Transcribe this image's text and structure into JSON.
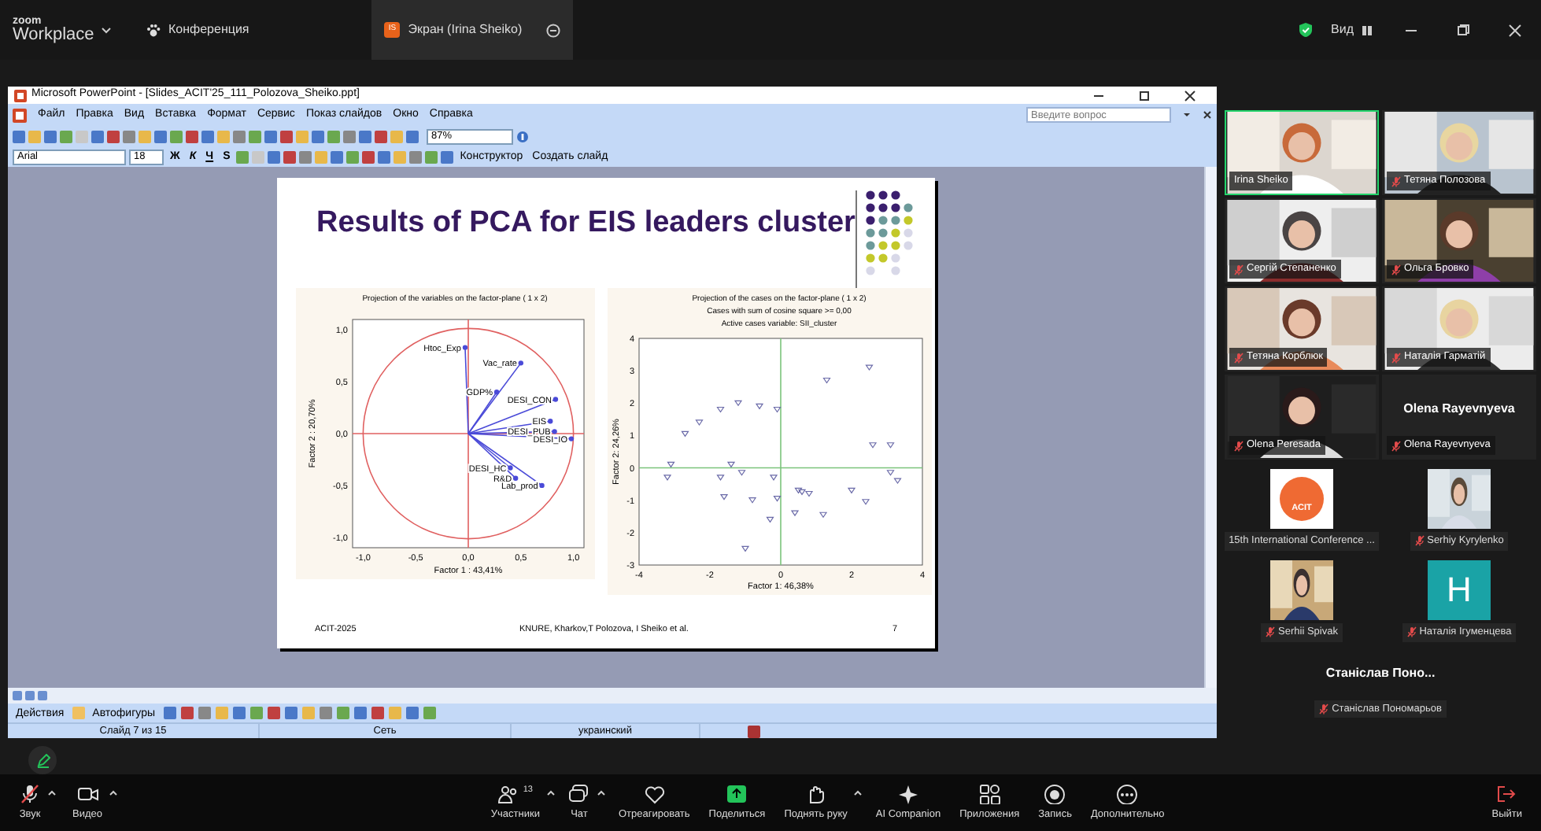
{
  "app": {
    "logo_top": "zoom",
    "logo_bottom": "Workplace",
    "meeting_tab": {
      "label": "Конференция",
      "selected": false
    },
    "share_tab": {
      "avatar": "IS",
      "label": "Экран (Irina Sheiko)",
      "selected": true
    },
    "view_label": "Вид"
  },
  "powerpoint": {
    "title": "Microsoft PowerPoint - [Slides_ACIT'25_111_Polozova_Sheiko.ppt]",
    "menu": [
      "Файл",
      "Правка",
      "Вид",
      "Вставка",
      "Формат",
      "Сервис",
      "Показ слайдов",
      "Окно",
      "Справка"
    ],
    "help_placeholder": "Введите вопрос",
    "zoom": "87%",
    "font": "Arial",
    "font_size": "18",
    "format_buttons": [
      "Ж",
      "К",
      "Ч",
      "S"
    ],
    "design_button": "Конструктор",
    "new_slide_button": "Создать слайд",
    "draw_actions": "Действия",
    "autoshapes": "Автофигуры",
    "status": [
      "Слайд 7 из 15",
      "Сеть",
      "украинский"
    ]
  },
  "slide": {
    "title": "Results of PCA for EIS leaders cluster",
    "panels": [
      {
        "kind": "vectors",
        "chart_data": {
          "type": "scatter",
          "title": "Projection of the variables on the factor-plane ( 1 x  2)",
          "xlabel": "Factor 1 : 43,41%",
          "ylabel": "Factor 2 : 20,70%",
          "xlim": [
            -1.1,
            1.1
          ],
          "ylim": [
            -1.1,
            1.1
          ],
          "xticks": [
            {
              "value": -1,
              "label": "-1,0"
            },
            {
              "value": -0.5,
              "label": "-0,5"
            },
            {
              "value": 0,
              "label": "0,0"
            },
            {
              "value": 0.5,
              "label": "0,5"
            },
            {
              "value": 1,
              "label": "1,0"
            }
          ],
          "yticks": [
            {
              "value": -1,
              "label": "-1,0"
            },
            {
              "value": -0.5,
              "label": "-0,5"
            },
            {
              "value": 0,
              "label": "0,0"
            },
            {
              "value": 0.5,
              "label": "0,5"
            },
            {
              "value": 1,
              "label": "1,0"
            }
          ],
          "annotations": [
            {
              "text": "Htoc_Exp",
              "x": -0.03,
              "y": 0.83
            },
            {
              "text": "Vac_rate",
              "x": 0.5,
              "y": 0.68
            },
            {
              "text": "GDP%",
              "x": 0.27,
              "y": 0.4
            },
            {
              "text": "DESI_CON",
              "x": 0.83,
              "y": 0.33
            },
            {
              "text": "EIS",
              "x": 0.78,
              "y": 0.12
            },
            {
              "text": "DESI_PUB",
              "x": 0.82,
              "y": 0.02
            },
            {
              "text": "DESI_IO",
              "x": 0.98,
              "y": -0.05
            },
            {
              "text": "DESI_HC",
              "x": 0.4,
              "y": -0.33
            },
            {
              "text": "R&D",
              "x": 0.45,
              "y": -0.43
            },
            {
              "text": "Lab_prod",
              "x": 0.7,
              "y": -0.5
            }
          ],
          "x": [
            -0.03,
            0.5,
            0.27,
            0.83,
            0.78,
            0.82,
            0.98,
            0.4,
            0.45,
            0.7
          ],
          "series": [
            {
              "color": "#4a4ad8",
              "values": [
                0.83,
                0.68,
                0.4,
                0.33,
                0.12,
                0.02,
                -0.05,
                -0.33,
                -0.43,
                -0.5
              ]
            }
          ]
        }
      },
      {
        "kind": "points",
        "chart_data": {
          "type": "scatter",
          "title": "Projection of the cases on the factor-plane ( 1 x  2)",
          "annotations": [
            "Cases with sum of cosine square >= 0,00",
            "Active cases variable: SII_cluster"
          ],
          "xlabel": "Factor 1: 46,38%",
          "ylabel": "Factor 2: 24,26%",
          "xlim": [
            -4,
            4
          ],
          "ylim": [
            -3,
            4
          ],
          "xticks": [
            {
              "value": -4,
              "label": "-4"
            },
            {
              "value": -2,
              "label": "-2"
            },
            {
              "value": 0,
              "label": "0"
            },
            {
              "value": 2,
              "label": "2"
            },
            {
              "value": 4,
              "label": "4"
            }
          ],
          "yticks": [
            {
              "value": -3,
              "label": "-3"
            },
            {
              "value": -2,
              "label": "-2"
            },
            {
              "value": -1,
              "label": "-1"
            },
            {
              "value": 0,
              "label": "0"
            },
            {
              "value": 1,
              "label": "1"
            },
            {
              "value": 2,
              "label": "2"
            },
            {
              "value": 3,
              "label": "3"
            },
            {
              "value": 4,
              "label": "4"
            }
          ],
          "x": [
            2.5,
            1.3,
            -1.2,
            -1.7,
            -0.6,
            -0.1,
            -2.3,
            -2.7,
            -3.1,
            -3.2,
            -1.4,
            -1.7,
            -1.1,
            -0.2,
            0.5,
            0.6,
            0.8,
            2.0,
            2.4,
            2.6,
            3.1,
            3.1,
            3.3,
            -1.6,
            -0.8,
            -0.1,
            0.4,
            1.2,
            -0.3,
            -1.0
          ],
          "series": [
            {
              "color": "#6a6aa8",
              "values": [
                3.1,
                2.7,
                2.0,
                1.8,
                1.9,
                1.8,
                1.4,
                1.05,
                0.1,
                -0.3,
                0.1,
                -0.3,
                -0.15,
                -0.3,
                -0.7,
                -0.75,
                -0.8,
                -0.7,
                -1.05,
                0.7,
                0.7,
                -0.15,
                -0.4,
                -0.9,
                -1.0,
                -0.95,
                -1.4,
                -1.45,
                -1.6,
                -2.5
              ]
            }
          ]
        }
      }
    ],
    "footer_left": "ACIT-2025",
    "footer_center": "KNURE, Kharkov,T Polozova, I Sheiko et al.",
    "page": "7"
  },
  "participants": [
    {
      "name": "Irina Sheiko",
      "kind": "video",
      "muted": false,
      "speaking": true
    },
    {
      "name": "Тетяна Полозова",
      "kind": "video",
      "muted": true,
      "speaking": false
    },
    {
      "name": "Сергій Степаненко",
      "kind": "video",
      "muted": true,
      "speaking": false
    },
    {
      "name": "Ольга Бровко",
      "kind": "video",
      "muted": true,
      "speaking": false
    },
    {
      "name": "Тетяна Корблюк",
      "kind": "video",
      "muted": true,
      "speaking": false
    },
    {
      "name": "Наталія Гарматій",
      "kind": "video",
      "muted": true,
      "speaking": false
    },
    {
      "name": "Olena Peresada",
      "kind": "video",
      "muted": true,
      "speaking": false
    },
    {
      "name": "Olena Rayevnyeva",
      "kind": "name",
      "display": "Olena Rayevnyeva",
      "muted": true,
      "speaking": false
    }
  ],
  "small_participants": [
    {
      "name": "15th International Conference ...",
      "kind": "logo",
      "logo_text": "ACIT",
      "muted": false
    },
    {
      "name": "Serhiy Kyrylenko",
      "muted": true
    },
    {
      "name": "Serhii Spivak",
      "muted": true
    },
    {
      "name": "Наталія Ігуменцева",
      "kind": "letter",
      "letter": "H",
      "muted": true
    },
    {
      "name": "Станіслав Пономарьов",
      "kind": "name",
      "display": "Станіслав  Поно...",
      "muted": true
    }
  ],
  "toolbar": [
    {
      "kind": "mic",
      "label": "Звук",
      "muted": true,
      "menu": true
    },
    {
      "kind": "video",
      "label": "Видео",
      "menu": true
    },
    {
      "kind": "people",
      "label": "Участники",
      "count": "13",
      "menu": true
    },
    {
      "kind": "chat",
      "label": "Чат",
      "menu": true
    },
    {
      "kind": "heart",
      "label": "Отреагировать",
      "menu": false
    },
    {
      "kind": "share",
      "label": "Поделиться",
      "menu": false
    },
    {
      "kind": "hand",
      "label": "Поднять руку",
      "menu": true
    },
    {
      "kind": "sparkle",
      "label": "AI Companion",
      "menu": false
    },
    {
      "kind": "apps",
      "label": "Приложения",
      "menu": false
    },
    {
      "kind": "record",
      "label": "Запись",
      "menu": false
    },
    {
      "kind": "more",
      "label": "Дополнительно",
      "menu": false
    }
  ],
  "leave": {
    "label": "Выйти"
  }
}
